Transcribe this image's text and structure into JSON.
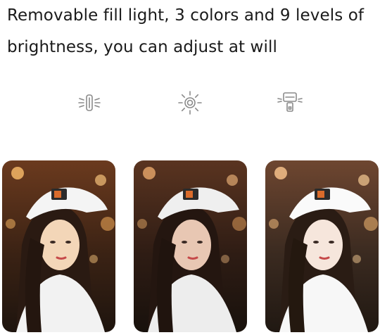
{
  "headline": {
    "line1": "Removable fill light, 3 colors and 9 levels of",
    "line2": "brightness, you can adjust at will"
  },
  "icons": [
    {
      "name": "tube-light-icon"
    },
    {
      "name": "sun-brightness-icon"
    },
    {
      "name": "clip-light-icon"
    }
  ],
  "photos": [
    {
      "name": "warm-light-photo",
      "tone": "#f3d6b8"
    },
    {
      "name": "neutral-light-photo",
      "tone": "#e8c7b3"
    },
    {
      "name": "cool-light-photo",
      "tone": "#f6e6dc"
    }
  ],
  "colors": {
    "text": "#1a1a1a",
    "icon": "#8a8a8a",
    "background": "#ffffff"
  }
}
